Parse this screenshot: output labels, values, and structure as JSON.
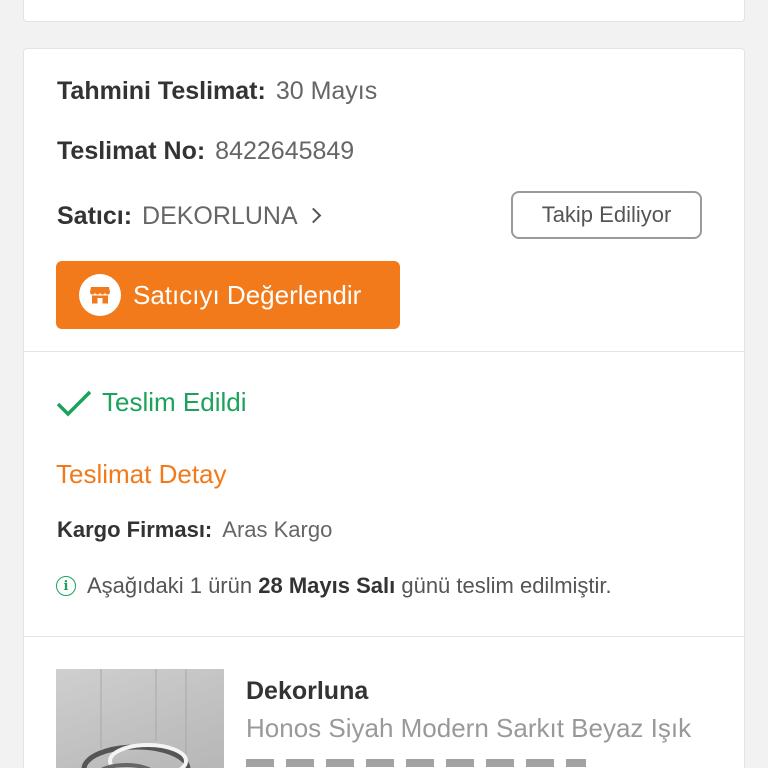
{
  "order": {
    "eta_label": "Tahmini Teslimat:",
    "eta_value": "30 Mayıs",
    "delivery_no_label": "Teslimat No:",
    "delivery_no_value": "8422645849",
    "seller_label": "Satıcı:",
    "seller_value": "DEKORLUNA",
    "follow_label": "Takip Ediliyor",
    "rate_seller_label": "Satıcıyı Değerlendir"
  },
  "delivery": {
    "status": "Teslim Edildi",
    "detail_title": "Teslimat Detay",
    "cargo_label": "Kargo Firması:",
    "cargo_value": "Aras Kargo",
    "info_prefix": "Aşağıdaki 1 ürün",
    "info_date": "28 Mayıs Salı",
    "info_suffix": "günü teslim edilmiştir."
  },
  "product": {
    "brand": "Dekorluna",
    "name": "Honos Siyah Modern Sarkıt Beyaz Işık"
  },
  "colors": {
    "accent": "#f27a1a",
    "success": "#1ba35c"
  },
  "icons": [
    "chevron-right-icon",
    "store-icon",
    "checkmark-icon",
    "info-icon"
  ]
}
